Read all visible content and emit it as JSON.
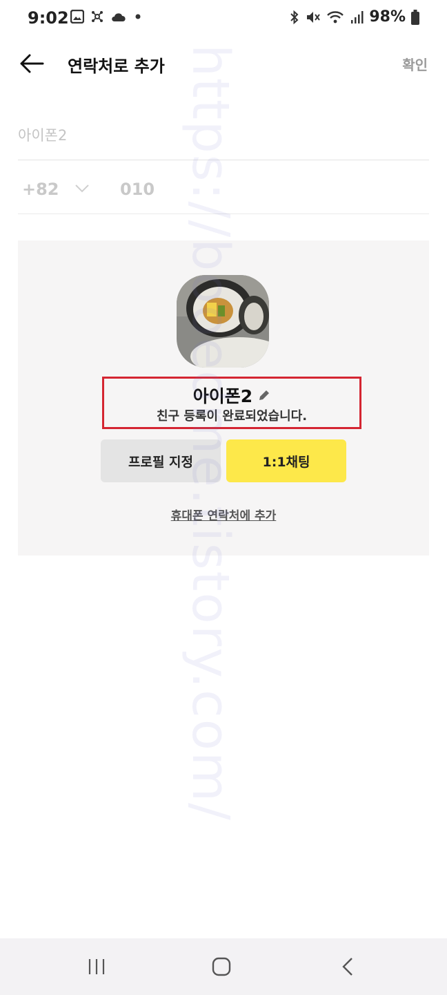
{
  "status_bar": {
    "time": "9:02",
    "battery": "98%",
    "left_icons": [
      "gallery-icon",
      "network-icon",
      "cloud-icon",
      "dot-icon"
    ],
    "right_icons": [
      "bluetooth-icon",
      "mute-icon",
      "wifi-icon",
      "signal-icon",
      "battery-icon"
    ]
  },
  "app_bar": {
    "title": "연락처로 추가",
    "confirm_label": "확인"
  },
  "form": {
    "name_value": "아이폰2",
    "country_code": "+82",
    "phone_value": "010"
  },
  "result": {
    "friend_name": "아이폰2",
    "message": "친구 등록이 완료되었습니다.",
    "profile_button": "프로필 지정",
    "chat_button": "1:1채팅",
    "add_contact_link": "휴대폰 연락처에 추가",
    "highlight_color": "#d42531",
    "chat_button_color": "#fde84a"
  },
  "watermark": "https://booedme.tistory.com/"
}
